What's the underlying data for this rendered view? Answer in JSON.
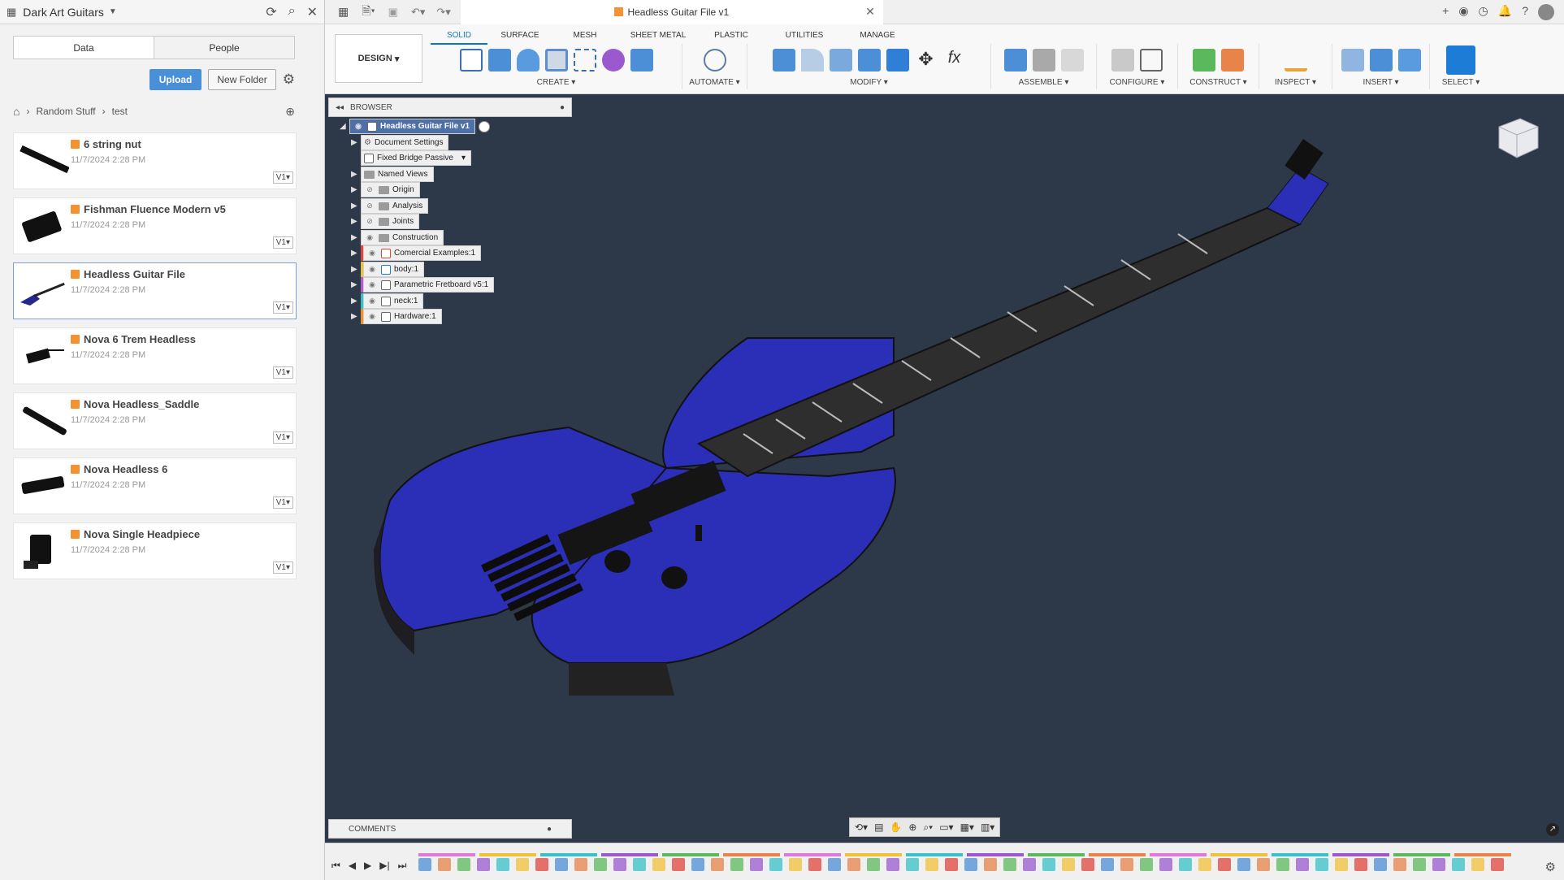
{
  "data_panel": {
    "project_title": "Dark Art Guitars",
    "tabs": [
      "Data",
      "People"
    ],
    "upload_label": "Upload",
    "new_folder_label": "New Folder",
    "breadcrumb": [
      "Random Stuff",
      "test"
    ],
    "files": [
      {
        "name": "6 string nut",
        "date": "11/7/2024 2:28 PM",
        "version": "V1"
      },
      {
        "name": "Fishman Fluence Modern v5",
        "date": "11/7/2024 2:28 PM",
        "version": "V1"
      },
      {
        "name": "Headless Guitar File",
        "date": "11/7/2024 2:28 PM",
        "version": "V1"
      },
      {
        "name": "Nova 6 Trem Headless",
        "date": "11/7/2024 2:28 PM",
        "version": "V1"
      },
      {
        "name": "Nova Headless_Saddle",
        "date": "11/7/2024 2:28 PM",
        "version": "V1"
      },
      {
        "name": "Nova Headless 6",
        "date": "11/7/2024 2:28 PM",
        "version": "V1"
      },
      {
        "name": "Nova Single Headpiece",
        "date": "11/7/2024 2:28 PM",
        "version": "V1"
      }
    ]
  },
  "document": {
    "tab_title": "Headless Guitar File v1"
  },
  "ribbon": {
    "workspace": "DESIGN",
    "tabs": [
      "SOLID",
      "SURFACE",
      "MESH",
      "SHEET METAL",
      "PLASTIC",
      "UTILITIES",
      "MANAGE"
    ],
    "groups": [
      "CREATE",
      "AUTOMATE",
      "MODIFY",
      "ASSEMBLE",
      "CONFIGURE",
      "CONSTRUCT",
      "INSPECT",
      "INSERT",
      "SELECT"
    ]
  },
  "browser": {
    "title": "BROWSER",
    "root": "Headless Guitar File v1",
    "items": [
      {
        "label": "Document Settings",
        "kind": "settings"
      },
      {
        "label": "Fixed Bridge Passive",
        "kind": "config"
      },
      {
        "label": "Named Views",
        "kind": "folder"
      },
      {
        "label": "Origin",
        "kind": "folder"
      },
      {
        "label": "Analysis",
        "kind": "folder"
      },
      {
        "label": "Joints",
        "kind": "folder"
      },
      {
        "label": "Construction",
        "kind": "folder"
      },
      {
        "label": "Comercial Examples:1",
        "kind": "component",
        "color": "#e0453c"
      },
      {
        "label": "body:1",
        "kind": "component",
        "color": "#e8c23a"
      },
      {
        "label": "Parametric Fretboard v5:1",
        "kind": "component",
        "color": "#b45bd1"
      },
      {
        "label": "neck:1",
        "kind": "component",
        "color": "#36c1c9"
      },
      {
        "label": "Hardware:1",
        "kind": "component",
        "color": "#f0902c"
      }
    ]
  },
  "comments_label": "COMMENTS",
  "colors": {
    "accent": "#0a76d1",
    "viewport_bg": "#2d3948",
    "guitar_body": "#2b2fb8",
    "upload_button": "#4a90d9"
  }
}
